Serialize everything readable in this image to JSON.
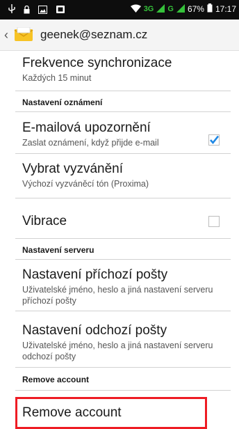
{
  "status_bar": {
    "network": "3G",
    "network2": "G",
    "battery": "67%",
    "time": "17:17"
  },
  "action_bar": {
    "back_icon": "chevron-left-icon",
    "app_icon": "mail-envelope-icon",
    "account": "geenek@seznam.cz"
  },
  "prefs": {
    "sync_freq": {
      "title": "Frekvence synchronizace",
      "summary": "Každých 15 minut"
    },
    "cat_notifications": "Nastavení oznámení",
    "email_notifications": {
      "title": "E-mailová upozornění",
      "summary": "Zaslat oznámení, když přijde e-mail",
      "checked": true
    },
    "ringtone": {
      "title": "Vybrat vyzvánění",
      "summary": "Výchozí vyzváněcí tón (Proxima)"
    },
    "vibrate": {
      "title": "Vibrace",
      "checked": false
    },
    "cat_server": "Nastavení serveru",
    "incoming": {
      "title": "Nastavení příchozí pošty",
      "summary": "Uživatelské jméno, heslo a jiná nastavení serveru příchozí pošty"
    },
    "outgoing": {
      "title": "Nastavení odchozí pošty",
      "summary": "Uživatelské jméno, heslo a jiná nastavení serveru odchozí pošty"
    },
    "cat_remove": "Remove account",
    "remove": {
      "title": "Remove account"
    }
  },
  "colors": {
    "highlight": "#ee1c24",
    "check": "#1e88e5",
    "network_green": "#35c23a"
  }
}
